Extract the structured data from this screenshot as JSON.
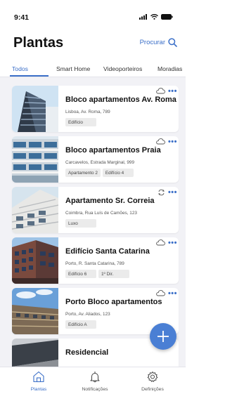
{
  "status_bar": {
    "time": "9:41"
  },
  "header": {
    "title": "Plantas",
    "search_label": "Procurar"
  },
  "tabs": [
    {
      "label": "Todos",
      "active": true
    },
    {
      "label": "Smart Home",
      "active": false
    },
    {
      "label": "Videoporteiros",
      "active": false
    },
    {
      "label": "Moradias",
      "active": false
    }
  ],
  "cards": [
    {
      "title": "Bloco apartamentos Av. Roma",
      "address": "Lisboa, Av. Roma, 789",
      "tags": [
        "Edifício"
      ],
      "status_icon": "cloud-icon"
    },
    {
      "title": "Bloco apartamentos Praia",
      "address": "Carcavelos, Estrada Marginal, 999",
      "tags": [
        "Apartamento 2",
        "Edifício 4"
      ],
      "status_icon": "cloud-icon"
    },
    {
      "title": "Apartamento Sr. Correia",
      "address": "Coimbra, Rua Luís de Camões, 123",
      "tags": [
        "Luxo"
      ],
      "status_icon": "sync-icon"
    },
    {
      "title": "Edifício Santa Catarina",
      "address": "Porto, R. Santa Catarina, 789",
      "tags": [
        "Edifício 6",
        "1º Dir."
      ],
      "status_icon": "cloud-icon"
    },
    {
      "title": "Porto Bloco apartamentos",
      "address": "Porto, Av. Aliados, 123",
      "tags": [
        "Edifício A"
      ],
      "status_icon": "cloud-icon"
    },
    {
      "title": "Residencial",
      "address": "",
      "tags": [],
      "status_icon": ""
    }
  ],
  "bottom_nav": [
    {
      "label": "Plantas",
      "icon": "home-icon",
      "active": true
    },
    {
      "label": "Notificações",
      "icon": "bell-icon",
      "active": false
    },
    {
      "label": "Definições",
      "icon": "gear-icon",
      "active": false
    }
  ],
  "colors": {
    "accent": "#3b6fc8",
    "fab": "#4a7fd4",
    "background": "#f2f2f6"
  }
}
